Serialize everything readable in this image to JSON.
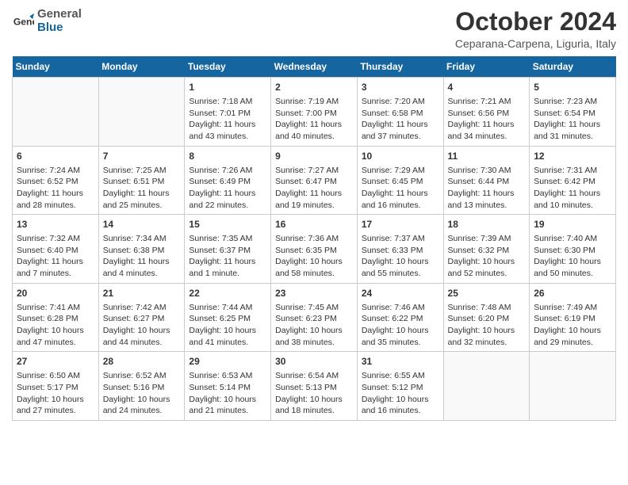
{
  "header": {
    "logo_line1": "General",
    "logo_line2": "Blue",
    "month": "October 2024",
    "location": "Ceparana-Carpena, Liguria, Italy"
  },
  "days_of_week": [
    "Sunday",
    "Monday",
    "Tuesday",
    "Wednesday",
    "Thursday",
    "Friday",
    "Saturday"
  ],
  "weeks": [
    [
      {
        "num": "",
        "sunrise": "",
        "sunset": "",
        "daylight": ""
      },
      {
        "num": "",
        "sunrise": "",
        "sunset": "",
        "daylight": ""
      },
      {
        "num": "1",
        "sunrise": "Sunrise: 7:18 AM",
        "sunset": "Sunset: 7:01 PM",
        "daylight": "Daylight: 11 hours and 43 minutes."
      },
      {
        "num": "2",
        "sunrise": "Sunrise: 7:19 AM",
        "sunset": "Sunset: 7:00 PM",
        "daylight": "Daylight: 11 hours and 40 minutes."
      },
      {
        "num": "3",
        "sunrise": "Sunrise: 7:20 AM",
        "sunset": "Sunset: 6:58 PM",
        "daylight": "Daylight: 11 hours and 37 minutes."
      },
      {
        "num": "4",
        "sunrise": "Sunrise: 7:21 AM",
        "sunset": "Sunset: 6:56 PM",
        "daylight": "Daylight: 11 hours and 34 minutes."
      },
      {
        "num": "5",
        "sunrise": "Sunrise: 7:23 AM",
        "sunset": "Sunset: 6:54 PM",
        "daylight": "Daylight: 11 hours and 31 minutes."
      }
    ],
    [
      {
        "num": "6",
        "sunrise": "Sunrise: 7:24 AM",
        "sunset": "Sunset: 6:52 PM",
        "daylight": "Daylight: 11 hours and 28 minutes."
      },
      {
        "num": "7",
        "sunrise": "Sunrise: 7:25 AM",
        "sunset": "Sunset: 6:51 PM",
        "daylight": "Daylight: 11 hours and 25 minutes."
      },
      {
        "num": "8",
        "sunrise": "Sunrise: 7:26 AM",
        "sunset": "Sunset: 6:49 PM",
        "daylight": "Daylight: 11 hours and 22 minutes."
      },
      {
        "num": "9",
        "sunrise": "Sunrise: 7:27 AM",
        "sunset": "Sunset: 6:47 PM",
        "daylight": "Daylight: 11 hours and 19 minutes."
      },
      {
        "num": "10",
        "sunrise": "Sunrise: 7:29 AM",
        "sunset": "Sunset: 6:45 PM",
        "daylight": "Daylight: 11 hours and 16 minutes."
      },
      {
        "num": "11",
        "sunrise": "Sunrise: 7:30 AM",
        "sunset": "Sunset: 6:44 PM",
        "daylight": "Daylight: 11 hours and 13 minutes."
      },
      {
        "num": "12",
        "sunrise": "Sunrise: 7:31 AM",
        "sunset": "Sunset: 6:42 PM",
        "daylight": "Daylight: 11 hours and 10 minutes."
      }
    ],
    [
      {
        "num": "13",
        "sunrise": "Sunrise: 7:32 AM",
        "sunset": "Sunset: 6:40 PM",
        "daylight": "Daylight: 11 hours and 7 minutes."
      },
      {
        "num": "14",
        "sunrise": "Sunrise: 7:34 AM",
        "sunset": "Sunset: 6:38 PM",
        "daylight": "Daylight: 11 hours and 4 minutes."
      },
      {
        "num": "15",
        "sunrise": "Sunrise: 7:35 AM",
        "sunset": "Sunset: 6:37 PM",
        "daylight": "Daylight: 11 hours and 1 minute."
      },
      {
        "num": "16",
        "sunrise": "Sunrise: 7:36 AM",
        "sunset": "Sunset: 6:35 PM",
        "daylight": "Daylight: 10 hours and 58 minutes."
      },
      {
        "num": "17",
        "sunrise": "Sunrise: 7:37 AM",
        "sunset": "Sunset: 6:33 PM",
        "daylight": "Daylight: 10 hours and 55 minutes."
      },
      {
        "num": "18",
        "sunrise": "Sunrise: 7:39 AM",
        "sunset": "Sunset: 6:32 PM",
        "daylight": "Daylight: 10 hours and 52 minutes."
      },
      {
        "num": "19",
        "sunrise": "Sunrise: 7:40 AM",
        "sunset": "Sunset: 6:30 PM",
        "daylight": "Daylight: 10 hours and 50 minutes."
      }
    ],
    [
      {
        "num": "20",
        "sunrise": "Sunrise: 7:41 AM",
        "sunset": "Sunset: 6:28 PM",
        "daylight": "Daylight: 10 hours and 47 minutes."
      },
      {
        "num": "21",
        "sunrise": "Sunrise: 7:42 AM",
        "sunset": "Sunset: 6:27 PM",
        "daylight": "Daylight: 10 hours and 44 minutes."
      },
      {
        "num": "22",
        "sunrise": "Sunrise: 7:44 AM",
        "sunset": "Sunset: 6:25 PM",
        "daylight": "Daylight: 10 hours and 41 minutes."
      },
      {
        "num": "23",
        "sunrise": "Sunrise: 7:45 AM",
        "sunset": "Sunset: 6:23 PM",
        "daylight": "Daylight: 10 hours and 38 minutes."
      },
      {
        "num": "24",
        "sunrise": "Sunrise: 7:46 AM",
        "sunset": "Sunset: 6:22 PM",
        "daylight": "Daylight: 10 hours and 35 minutes."
      },
      {
        "num": "25",
        "sunrise": "Sunrise: 7:48 AM",
        "sunset": "Sunset: 6:20 PM",
        "daylight": "Daylight: 10 hours and 32 minutes."
      },
      {
        "num": "26",
        "sunrise": "Sunrise: 7:49 AM",
        "sunset": "Sunset: 6:19 PM",
        "daylight": "Daylight: 10 hours and 29 minutes."
      }
    ],
    [
      {
        "num": "27",
        "sunrise": "Sunrise: 6:50 AM",
        "sunset": "Sunset: 5:17 PM",
        "daylight": "Daylight: 10 hours and 27 minutes."
      },
      {
        "num": "28",
        "sunrise": "Sunrise: 6:52 AM",
        "sunset": "Sunset: 5:16 PM",
        "daylight": "Daylight: 10 hours and 24 minutes."
      },
      {
        "num": "29",
        "sunrise": "Sunrise: 6:53 AM",
        "sunset": "Sunset: 5:14 PM",
        "daylight": "Daylight: 10 hours and 21 minutes."
      },
      {
        "num": "30",
        "sunrise": "Sunrise: 6:54 AM",
        "sunset": "Sunset: 5:13 PM",
        "daylight": "Daylight: 10 hours and 18 minutes."
      },
      {
        "num": "31",
        "sunrise": "Sunrise: 6:55 AM",
        "sunset": "Sunset: 5:12 PM",
        "daylight": "Daylight: 10 hours and 16 minutes."
      },
      {
        "num": "",
        "sunrise": "",
        "sunset": "",
        "daylight": ""
      },
      {
        "num": "",
        "sunrise": "",
        "sunset": "",
        "daylight": ""
      }
    ]
  ]
}
